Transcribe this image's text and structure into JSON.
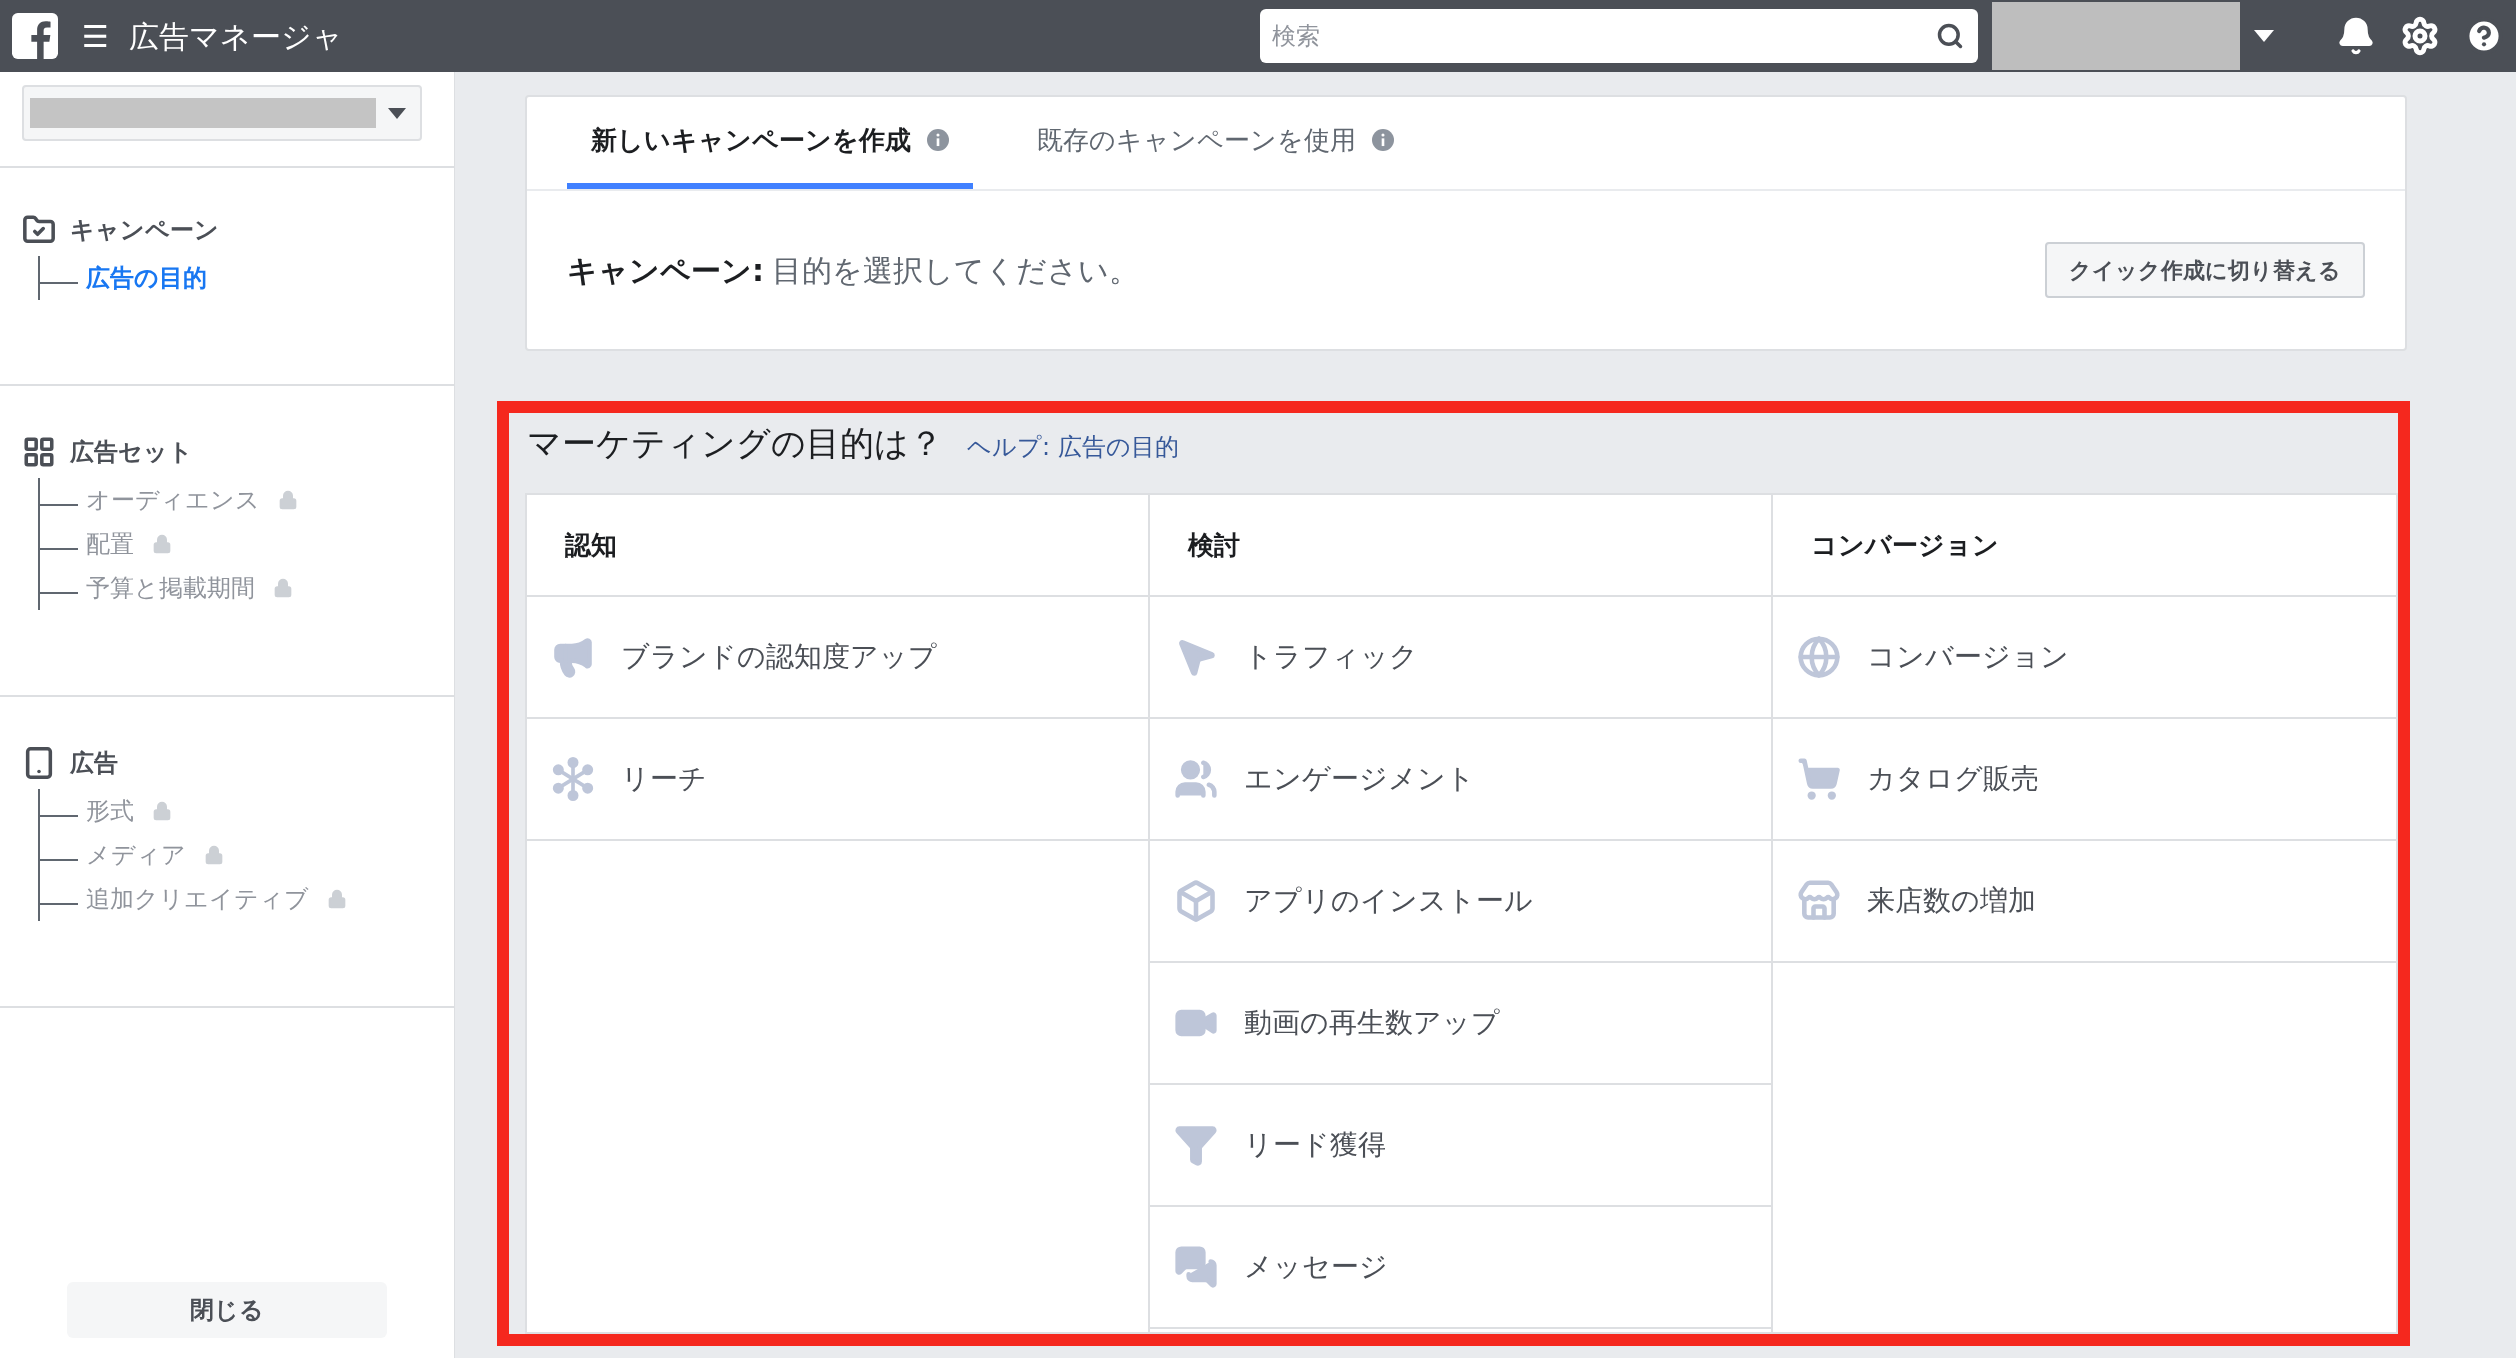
{
  "topbar": {
    "title": "広告マネージャ",
    "menu_glyph": "☰",
    "search": {
      "placeholder": "検索"
    }
  },
  "sidebar": {
    "sections": [
      {
        "title": "キャンペーン",
        "items": [
          {
            "label": "広告の目的",
            "selected": true,
            "locked": false
          }
        ]
      },
      {
        "title": "広告セット",
        "items": [
          {
            "label": "オーディエンス",
            "selected": false,
            "locked": true
          },
          {
            "label": "配置",
            "selected": false,
            "locked": true
          },
          {
            "label": "予算と掲載期間",
            "selected": false,
            "locked": true
          }
        ]
      },
      {
        "title": "広告",
        "items": [
          {
            "label": "形式",
            "selected": false,
            "locked": true
          },
          {
            "label": "メディア",
            "selected": false,
            "locked": true
          },
          {
            "label": "追加クリエイティブ",
            "selected": false,
            "locked": true
          }
        ]
      }
    ],
    "close_button": "閉じる"
  },
  "tabs": [
    {
      "label": "新しいキャンペーンを作成",
      "selected": true
    },
    {
      "label": "既存のキャンペーンを使用",
      "selected": false
    }
  ],
  "campaign": {
    "label": "キャンペーン:",
    "value": "目的を選択してください。",
    "quick_button": "クイック作成に切り替える"
  },
  "objectives": {
    "title": "マーケティングの目的は？",
    "help_link": "ヘルプ: 広告の目的",
    "columns": [
      {
        "heading": "認知",
        "items": [
          {
            "label": "ブランドの認知度アップ"
          },
          {
            "label": "リーチ"
          }
        ]
      },
      {
        "heading": "検討",
        "items": [
          {
            "label": "トラフィック"
          },
          {
            "label": "エンゲージメント"
          },
          {
            "label": "アプリのインストール"
          },
          {
            "label": "動画の再生数アップ"
          },
          {
            "label": "リード獲得"
          },
          {
            "label": "メッセージ"
          }
        ]
      },
      {
        "heading": "コンバージョン",
        "items": [
          {
            "label": "コンバージョン"
          },
          {
            "label": "カタログ販売"
          },
          {
            "label": "来店数の増加"
          }
        ]
      }
    ]
  }
}
